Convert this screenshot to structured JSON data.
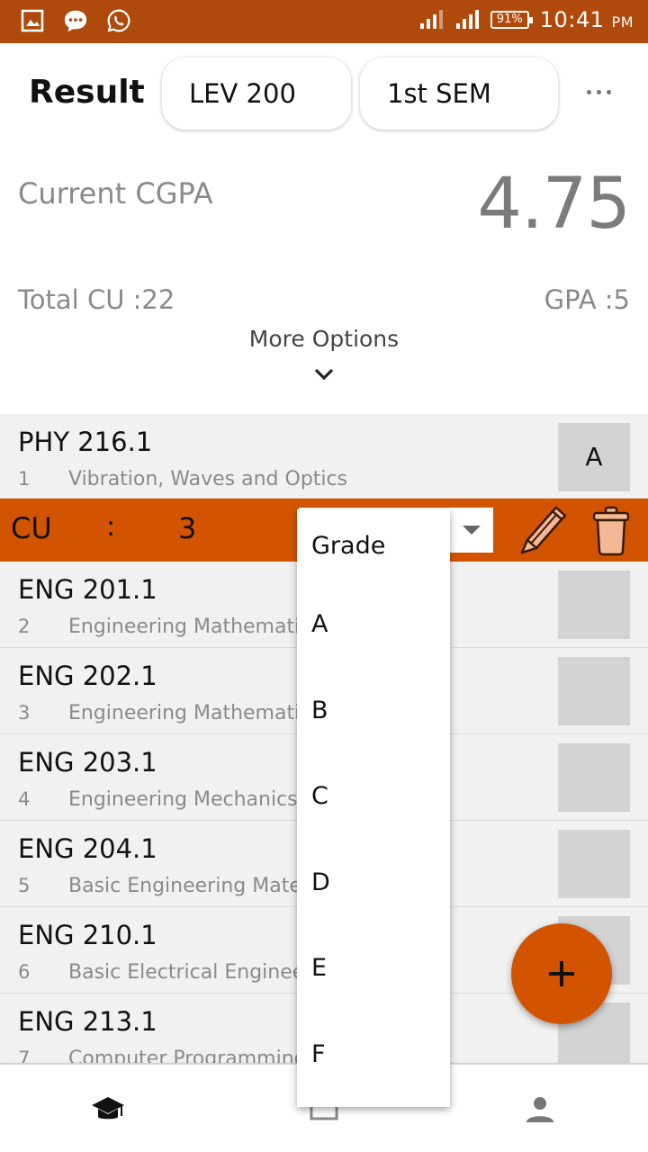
{
  "status_bar": {
    "battery": "91%",
    "time": "10:41",
    "ampm": "PM",
    "icons": [
      "image-icon",
      "chat-icon",
      "whatsapp-icon",
      "signal-icon",
      "signal-icon"
    ]
  },
  "header": {
    "title": "Result",
    "level": "LEV 200",
    "semester": "1st SEM",
    "current_cgpa_label": "Current CGPA",
    "current_cgpa_value": "4.75",
    "total_cu": "Total CU  :22",
    "gpa": "GPA  :5",
    "more_options": "More Options"
  },
  "courses": [
    {
      "code": "PHY 216.1",
      "index": "1",
      "name": "Vibration, Waves and Optics",
      "grade": "A"
    },
    {
      "code": "ENG 201.1",
      "index": "2",
      "name": "Engineering Mathematics",
      "grade": ""
    },
    {
      "code": "ENG 202.1",
      "index": "3",
      "name": "Engineering Mathematics",
      "grade": ""
    },
    {
      "code": "ENG 203.1",
      "index": "4",
      "name": "Engineering Mechanics",
      "grade": ""
    },
    {
      "code": "ENG 204.1",
      "index": "5",
      "name": "Basic Engineering Materials",
      "grade": ""
    },
    {
      "code": "ENG 210.1",
      "index": "6",
      "name": "Basic Electrical Engineering",
      "grade": ""
    },
    {
      "code": "ENG 213.1",
      "index": "7",
      "name": "Computer Programming",
      "grade": ""
    }
  ],
  "edit_bar": {
    "cu_label": "CU",
    "colon": ":",
    "cu_value": "3"
  },
  "grade_dropdown": {
    "options": [
      "Grade",
      "A",
      "B",
      "C",
      "D",
      "E",
      "F"
    ]
  },
  "colors": {
    "status_bar": "#b04a0c",
    "accent": "#d35400",
    "grade_box": "#d3d3d4"
  }
}
